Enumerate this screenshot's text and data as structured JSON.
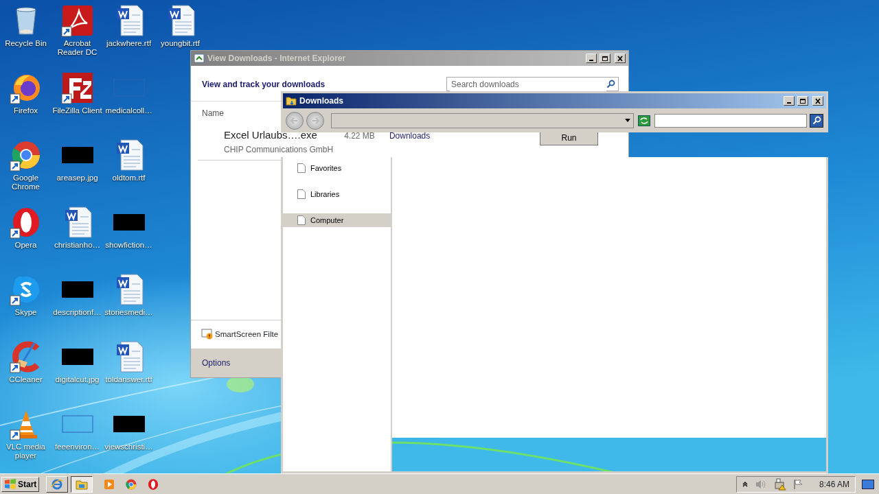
{
  "desktop_icons": [
    {
      "label": "Recycle Bin",
      "kind": "recycle",
      "shortcut": false
    },
    {
      "label": "Firefox",
      "kind": "firefox",
      "shortcut": true
    },
    {
      "label": "Google Chrome",
      "kind": "chrome",
      "shortcut": true
    },
    {
      "label": "Opera",
      "kind": "opera",
      "shortcut": true
    },
    {
      "label": "Skype",
      "kind": "skype",
      "shortcut": true
    },
    {
      "label": "CCleaner",
      "kind": "ccleaner",
      "shortcut": true
    },
    {
      "label": "VLC media player",
      "kind": "vlc",
      "shortcut": true
    },
    {
      "label": "Acrobat Reader DC",
      "kind": "acrobat",
      "shortcut": true
    },
    {
      "label": "FileZilla Client",
      "kind": "filezilla",
      "shortcut": true
    },
    {
      "label": "areasep.jpg",
      "kind": "dark_image",
      "shortcut": false
    },
    {
      "label": "christianho…",
      "kind": "word",
      "shortcut": false
    },
    {
      "label": "descriptionf…",
      "kind": "dark_image",
      "shortcut": false
    },
    {
      "label": "digitalcut.jpg",
      "kind": "dark_image",
      "shortcut": false
    },
    {
      "label": "feeenviron…",
      "kind": "blank_image",
      "shortcut": false
    },
    {
      "label": "jackwhere.rtf",
      "kind": "word",
      "shortcut": false
    },
    {
      "label": "medicalcoll…",
      "kind": "blank_image",
      "shortcut": false
    },
    {
      "label": "oldtom.rtf",
      "kind": "word",
      "shortcut": false
    },
    {
      "label": "showfiction…",
      "kind": "dark_image",
      "shortcut": false
    },
    {
      "label": "storiesmedi…",
      "kind": "word",
      "shortcut": false
    },
    {
      "label": "toldanswer.rtf",
      "kind": "word",
      "shortcut": false
    },
    {
      "label": "viewschristi…",
      "kind": "dark_image",
      "shortcut": false
    },
    {
      "label": "youngbit.rtf",
      "kind": "word",
      "shortcut": false
    }
  ],
  "ie_window": {
    "title": "View Downloads - Internet Explorer",
    "active": false,
    "heading": "View and track your downloads",
    "search": {
      "placeholder": "Search downloads"
    },
    "column_header": "Name",
    "download": {
      "name": "Excel Urlaubs….exe",
      "size": "4.22 MB",
      "location": "Downloads",
      "publisher": "CHIP Communications GmbH",
      "action": "Run"
    },
    "smartscreen": "SmartScreen Filte",
    "options": "Options"
  },
  "explorer_window": {
    "title": "Downloads",
    "active": true,
    "nav_items": [
      {
        "label": "Favorites",
        "selected": false
      },
      {
        "label": "Libraries",
        "selected": false
      },
      {
        "label": "Computer",
        "selected": true
      }
    ]
  },
  "taskbar": {
    "start": "Start",
    "buttons": [
      {
        "kind": "ie",
        "selected": false
      },
      {
        "kind": "explorer",
        "selected": true
      }
    ],
    "quick_launch": [
      {
        "kind": "media"
      },
      {
        "kind": "chrome"
      },
      {
        "kind": "opera"
      }
    ],
    "clock": "8:46 AM"
  }
}
